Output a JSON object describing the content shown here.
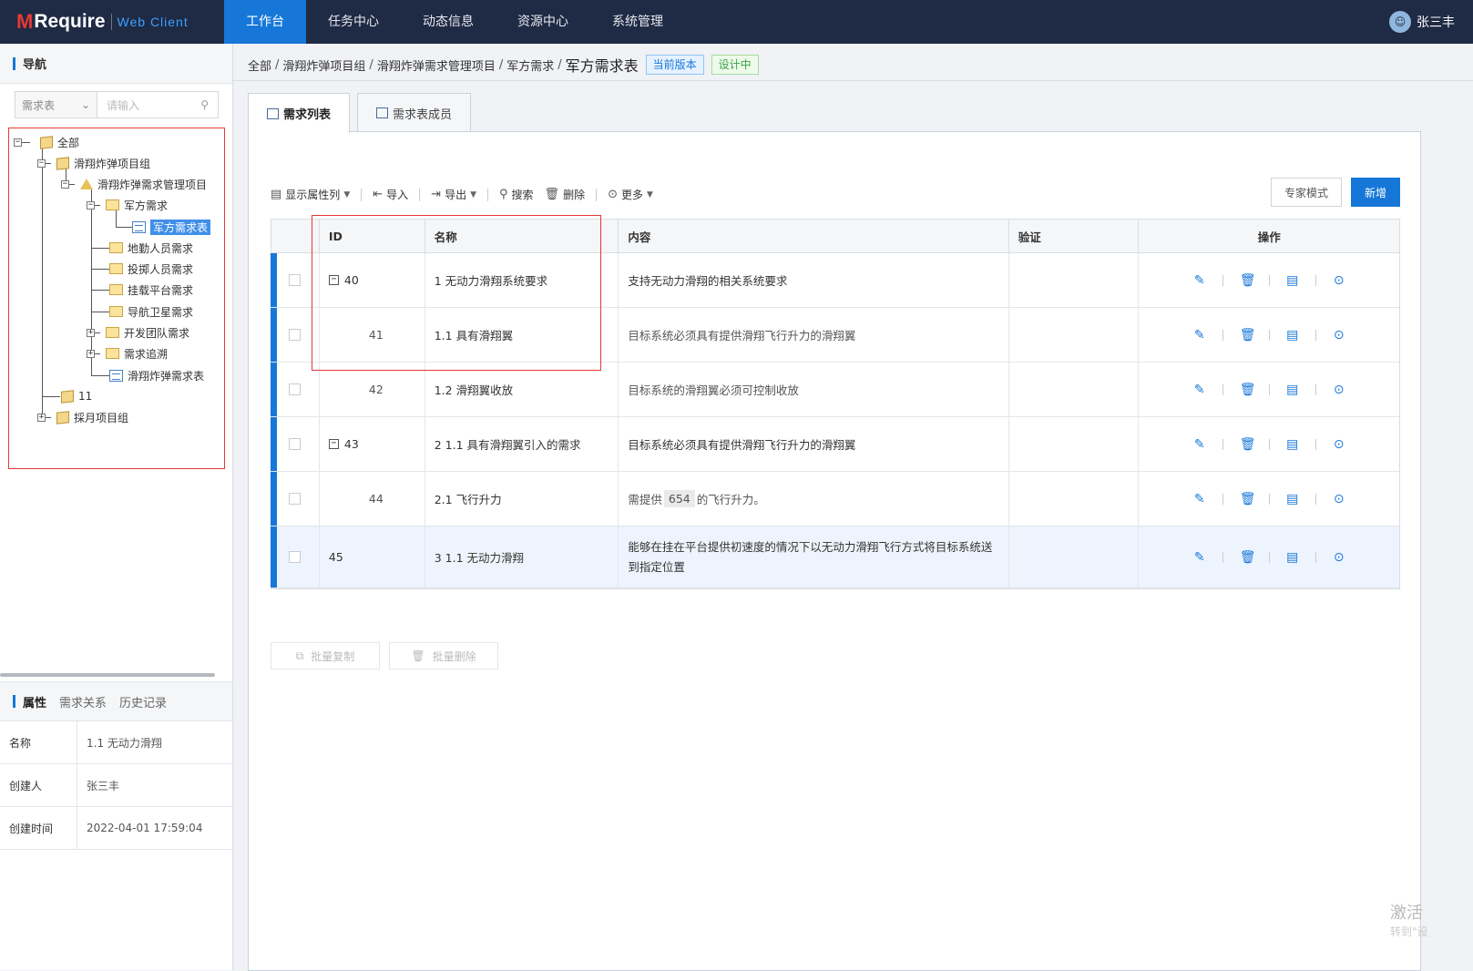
{
  "app": {
    "logo_mark": "M",
    "logo_text": "Require",
    "logo_sub": "Web Client"
  },
  "nav": [
    {
      "label": "工作台",
      "active": true
    },
    {
      "label": "任务中心"
    },
    {
      "label": "动态信息"
    },
    {
      "label": "资源中心"
    },
    {
      "label": "系统管理"
    }
  ],
  "user": {
    "name": "张三丰"
  },
  "sidebar": {
    "title": "导航",
    "search_select": "需求表",
    "search_placeholder": "请输入",
    "tree": [
      {
        "label": "全部",
        "icon": "box-icon"
      },
      {
        "label": "滑翔炸弹项目组",
        "icon": "box-icon"
      },
      {
        "label": "滑翔炸弹需求管理项目",
        "icon": "project-icon"
      },
      {
        "label": "军方需求",
        "icon": "folder-icon"
      },
      {
        "label": "军方需求表",
        "icon": "table-icon",
        "selected": true
      },
      {
        "label": "地勤人员需求",
        "icon": "folder-icon"
      },
      {
        "label": "投掷人员需求",
        "icon": "folder-icon"
      },
      {
        "label": "挂载平台需求",
        "icon": "folder-icon"
      },
      {
        "label": "导航卫星需求",
        "icon": "folder-icon"
      },
      {
        "label": "开发团队需求",
        "icon": "folder-icon"
      },
      {
        "label": "需求追溯",
        "icon": "folder-icon"
      },
      {
        "label": "滑翔炸弹需求表",
        "icon": "table-icon"
      },
      {
        "label": "11",
        "icon": "box-icon"
      },
      {
        "label": "採月项目组",
        "icon": "box-icon"
      }
    ]
  },
  "props": {
    "tabs": [
      "属性",
      "需求关系",
      "历史记录"
    ],
    "rows": [
      {
        "key": "名称",
        "value": "1.1 无动力滑翔"
      },
      {
        "key": "创建人",
        "value": "张三丰"
      },
      {
        "key": "创建时间",
        "value": "2022-04-01 17:59:04"
      }
    ]
  },
  "breadcrumb": {
    "items": [
      "全部",
      "滑翔炸弹项目组",
      "滑翔炸弹需求管理项目",
      "军方需求"
    ],
    "current": "军方需求表",
    "badge_version": "当前版本",
    "badge_status": "设计中"
  },
  "tabs": [
    "需求列表",
    "需求表成员"
  ],
  "toolbar": {
    "show_cols": "显示属性列",
    "import": "导入",
    "export": "导出",
    "search": "搜索",
    "delete": "删除",
    "more": "更多",
    "expert": "专家模式",
    "new": "新增"
  },
  "table": {
    "headers": [
      "ID",
      "名称",
      "内容",
      "验证",
      "操作"
    ],
    "rows": [
      {
        "id": "40",
        "name": "1 无动力滑翔系统要求",
        "content": "支持无动力滑翔的相关系统要求",
        "level": 0
      },
      {
        "id": "41",
        "name": "1.1 具有滑翔翼",
        "content": "目标系统必须具有提供滑翔飞行升力的滑翔翼",
        "level": 1
      },
      {
        "id": "42",
        "name": "1.2 滑翔翼收放",
        "content": "目标系统的滑翔翼必须可控制收放",
        "level": 1
      },
      {
        "id": "43",
        "name": "2 1.1 具有滑翔翼引入的需求",
        "content": "目标系统必须具有提供滑翔飞行升力的滑翔翼",
        "level": 0
      },
      {
        "id": "44",
        "name": "2.1 飞行升力",
        "content_pre": "需提供",
        "content_hl": "654",
        "content_post": "的飞行升力。",
        "level": 1
      },
      {
        "id": "45",
        "name": "3 1.1 无动力滑翔",
        "content": "能够在挂在平台提供初速度的情况下以无动力滑翔飞行方式将目标系统送到指定位置",
        "level": 0
      }
    ]
  },
  "bulk": {
    "copy": "批量复制",
    "delete": "批量删除"
  },
  "watermark": {
    "line1": "激活",
    "line2": "转到\"设"
  }
}
